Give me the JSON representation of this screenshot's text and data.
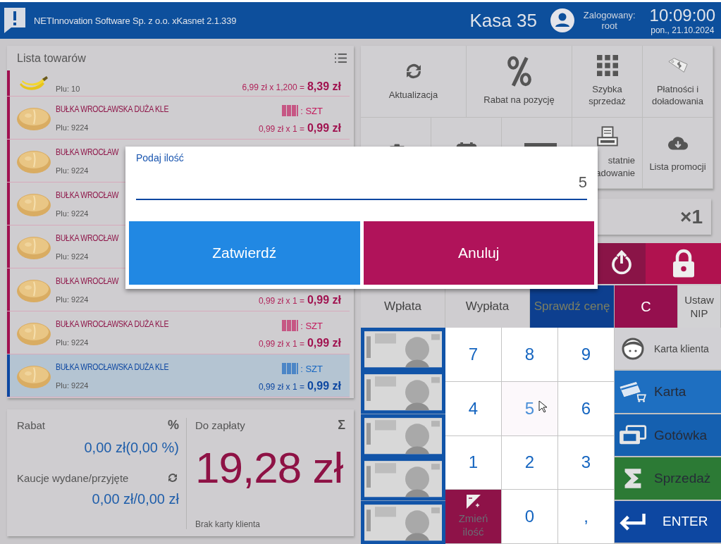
{
  "header": {
    "company": "NETInnovation Software Sp. z o.o. xKasnet 2.1.339",
    "register": "Kasa 35",
    "logged_label": "Zalogowany:",
    "user": "root",
    "time": "10:09:00",
    "date": "pon., 21.10.2024"
  },
  "products": {
    "title": "Lista towarów",
    "items": [
      {
        "kind": "weighed",
        "plu": "Plu: 10",
        "price_line": "6,99 zł x 1,200 =",
        "total": "8,39 zł",
        "selected": false
      },
      {
        "kind": "piece",
        "name": "BUŁKA WROCŁAWSKA DUŻA KLE",
        "unit": ": SZT",
        "plu": "Plu: 9224",
        "price_line": "0,99 zł x 1 =",
        "total": "0,99 zł",
        "selected": false
      },
      {
        "kind": "piece",
        "name": "BUŁKA WROCŁAW",
        "plu": "Plu: 9224",
        "selected": false
      },
      {
        "kind": "piece",
        "name": "BUŁKA WROCŁAW",
        "plu": "Plu: 9224",
        "selected": false
      },
      {
        "kind": "piece",
        "name": "BUŁKA WROCŁAW",
        "plu": "Plu: 9224",
        "selected": false
      },
      {
        "kind": "piece",
        "name": "BUŁKA WROCŁAW",
        "plu": "Plu: 9224",
        "price_line": "0,99 zł x 1 =",
        "total": "0,99 zł",
        "selected": false
      },
      {
        "kind": "piece",
        "name": "BUŁKA WROCŁAWSKA DUŻA KLE",
        "unit": ": SZT",
        "plu": "Plu: 9224",
        "price_line": "0,99 zł x 1 =",
        "total": "0,99 zł",
        "selected": false
      },
      {
        "kind": "piece",
        "name": "BUŁKA WROCŁAWSKA DUŻA KLE",
        "unit": ": SZT",
        "plu": "Plu: 9224",
        "price_line": "0,99 zł x 1 =",
        "total": "0,99 zł",
        "selected": true
      }
    ]
  },
  "summary": {
    "discount_label": "Rabat",
    "discount_sign": "%",
    "discount_value": "0,00 zł(0,00 %)",
    "deposit_label": "Kaucje wydane/przyjęte",
    "deposit_value": "0,00 zł/0,00 zł",
    "due_label": "Do zapłaty",
    "due_sign": "Σ",
    "due_total": "19,28 zł",
    "customer_note": "Brak karty klienta"
  },
  "tools_row_1": [
    {
      "label": "Aktualizacja"
    },
    {
      "label": "Rabat na pozycję"
    },
    {
      "label": "Szybka sprzedaż"
    },
    {
      "label": "Płatności i doładowania"
    }
  ],
  "tools_row_2": [
    {
      "kind": "icon"
    },
    {
      "kind": "icon"
    },
    {
      "kind": "icon"
    },
    {
      "kind": "labeled",
      "label": "statnie adowanie",
      "cut_left": true
    },
    {
      "kind": "labeled",
      "label": "Lista promocji",
      "cut_left": false
    }
  ],
  "quantity": "×1",
  "function_keys": [
    {
      "label": "Wpłata",
      "kind": "plain",
      "disabled": false
    },
    {
      "label": "Wypłata",
      "kind": "plain",
      "disabled": false
    },
    {
      "label": "Sprawdź cenę",
      "kind": "primary",
      "disabled": true
    },
    {
      "label": "C",
      "kind": "danger",
      "disabled": false
    },
    {
      "label": "Ustaw NIP",
      "kind": "small",
      "disabled": false
    }
  ],
  "keypad": [
    {
      "label": "7",
      "kind": "digit",
      "hovered": false
    },
    {
      "label": "8",
      "kind": "digit",
      "hovered": false
    },
    {
      "label": "9",
      "kind": "digit",
      "hovered": false
    },
    {
      "label": "4",
      "kind": "digit",
      "hovered": false
    },
    {
      "label": "5",
      "kind": "digit",
      "hovered": true
    },
    {
      "label": "6",
      "kind": "digit",
      "hovered": false
    },
    {
      "label": "1",
      "kind": "digit",
      "hovered": false
    },
    {
      "label": "2",
      "kind": "digit",
      "hovered": false
    },
    {
      "label": "3",
      "kind": "digit",
      "hovered": false
    },
    {
      "label": "Zmień ilość",
      "kind": "action",
      "disabled": true
    },
    {
      "label": "0",
      "kind": "digit",
      "hovered": false
    },
    {
      "label": ",",
      "kind": "digit",
      "hovered": false
    }
  ],
  "payments": [
    {
      "label": "Karta klienta",
      "kind": "customer",
      "disabled": false
    },
    {
      "label": "Karta",
      "kind": "card",
      "disabled": true
    },
    {
      "label": "Gotówka",
      "kind": "cash",
      "disabled": true
    },
    {
      "label": "Sprzedaż",
      "kind": "sale",
      "disabled": true
    },
    {
      "label": "ENTER",
      "kind": "enter",
      "disabled": false
    }
  ],
  "dialog": {
    "label": "Podaj ilość",
    "value": "5",
    "buttons": [
      {
        "label": "Zatwierdź",
        "kind": "confirm"
      },
      {
        "label": "Anuluj",
        "kind": "cancel"
      }
    ]
  }
}
